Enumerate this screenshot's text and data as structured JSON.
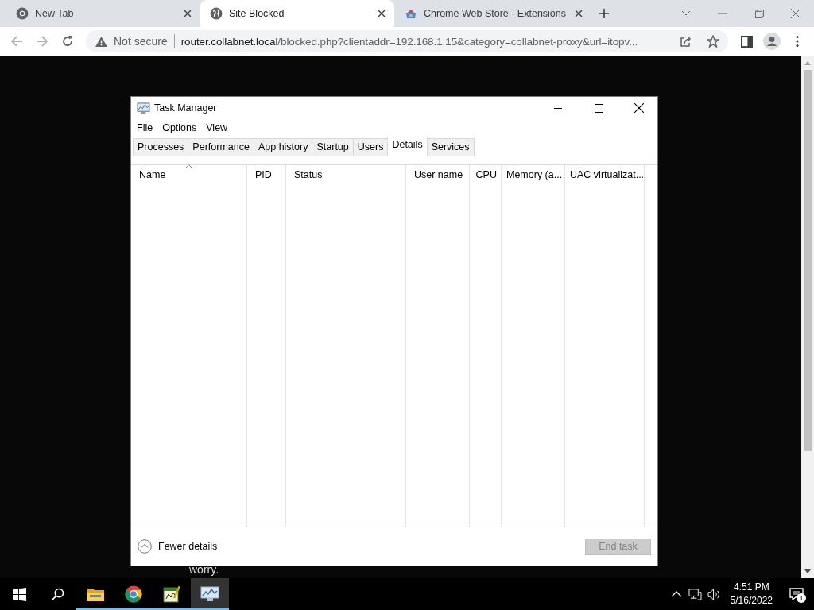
{
  "browser": {
    "tabs": [
      {
        "title": "New Tab",
        "kind": "chrome",
        "selected": false
      },
      {
        "title": "Site Blocked",
        "kind": "globe",
        "selected": true
      },
      {
        "title": "Chrome Web Store - Extensions",
        "kind": "store",
        "selected": false
      }
    ],
    "security": "Not secure",
    "url_host": "router.collabnet.local",
    "url_rest": "/blocked.php?clientaddr=192.168.1.15&category=collabnet-proxy&url=itopv..."
  },
  "page": {
    "partial_text": "worry."
  },
  "task_manager": {
    "title": "Task Manager",
    "menu": [
      "File",
      "Options",
      "View"
    ],
    "tabs": [
      {
        "label": "Processes",
        "selected": false
      },
      {
        "label": "Performance",
        "selected": false
      },
      {
        "label": "App history",
        "selected": false
      },
      {
        "label": "Startup",
        "selected": false
      },
      {
        "label": "Users",
        "selected": false
      },
      {
        "label": "Details",
        "selected": true
      },
      {
        "label": "Services",
        "selected": false
      }
    ],
    "columns": [
      {
        "label": "Name",
        "sorted": true
      },
      {
        "label": "PID",
        "sorted": false
      },
      {
        "label": "Status",
        "sorted": false
      },
      {
        "label": "User name",
        "sorted": false
      },
      {
        "label": "CPU",
        "sorted": false
      },
      {
        "label": "Memory (a...",
        "sorted": false
      },
      {
        "label": "UAC virtualizat...",
        "sorted": false
      }
    ],
    "fewer_details": "Fewer details",
    "end_task": {
      "label": "End task",
      "disabled": true
    }
  },
  "taskbar": {
    "items": [
      {
        "kind": "start",
        "running": false,
        "active": false
      },
      {
        "kind": "search",
        "running": false,
        "active": false
      },
      {
        "kind": "folder",
        "running": true,
        "active": false
      },
      {
        "kind": "chrome",
        "running": true,
        "active": false
      },
      {
        "kind": "notepad",
        "running": true,
        "active": false
      },
      {
        "kind": "taskmgr",
        "running": true,
        "active": true
      }
    ],
    "time": "4:51 PM",
    "date": "5/16/2022",
    "notifications": "1"
  }
}
